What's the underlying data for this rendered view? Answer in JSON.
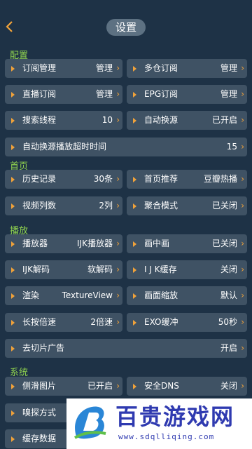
{
  "header": {
    "title": "设置",
    "back_icon": "chevron-left-icon"
  },
  "sections": {
    "config": "配置",
    "home": "首页",
    "playback": "播放",
    "system": "系统"
  },
  "items": {
    "sub_manage": {
      "label": "订阅管理",
      "value": "管理"
    },
    "multi_sub": {
      "label": "多仓订阅",
      "value": "管理"
    },
    "live_sub": {
      "label": "直播订阅",
      "value": "管理"
    },
    "epg_sub": {
      "label": "EPG订阅",
      "value": "管理"
    },
    "search_threads": {
      "label": "搜索线程",
      "value": "10"
    },
    "auto_switch": {
      "label": "自动换源",
      "value": "已开启"
    },
    "auto_switch_timeout": {
      "label": "自动换源播放超时时间",
      "value": "15"
    },
    "history": {
      "label": "历史记录",
      "value": "30条"
    },
    "home_recommend": {
      "label": "首页推荐",
      "value": "豆瓣热播"
    },
    "video_columns": {
      "label": "视频列数",
      "value": "2列"
    },
    "aggregate_mode": {
      "label": "聚合模式",
      "value": "已关闭"
    },
    "player": {
      "label": "播放器",
      "value": "IJK播放器"
    },
    "pip": {
      "label": "画中画",
      "value": "已关闭"
    },
    "ijk_decode": {
      "label": "IJK解码",
      "value": "软解码"
    },
    "ijk_cache": {
      "label": "I J K缓存",
      "value": "关闭"
    },
    "render": {
      "label": "渲染",
      "value": "TextureView"
    },
    "scale": {
      "label": "画面缩放",
      "value": "默认"
    },
    "long_press_speed": {
      "label": "长按倍速",
      "value": "2倍速"
    },
    "exo_buffer": {
      "label": "EXO缓冲",
      "value": "50秒"
    },
    "skip_ads": {
      "label": "去切片广告",
      "value": "开启"
    },
    "side_image": {
      "label": "侧滑图片",
      "value": "已开启"
    },
    "secure_dns": {
      "label": "安全DNS",
      "value": "关闭"
    },
    "sniff_mode": {
      "label": "嗅探方式"
    },
    "cache_data": {
      "label": "缓存数据"
    }
  },
  "watermark": {
    "text": "百贵游戏网",
    "url": "www.sdqlliqing.com"
  },
  "colors": {
    "background": "#1e3246",
    "item": "#3f5264",
    "accent": "#f0a23a",
    "section": "#8fd14f",
    "watermark": "#2f3ab0"
  }
}
